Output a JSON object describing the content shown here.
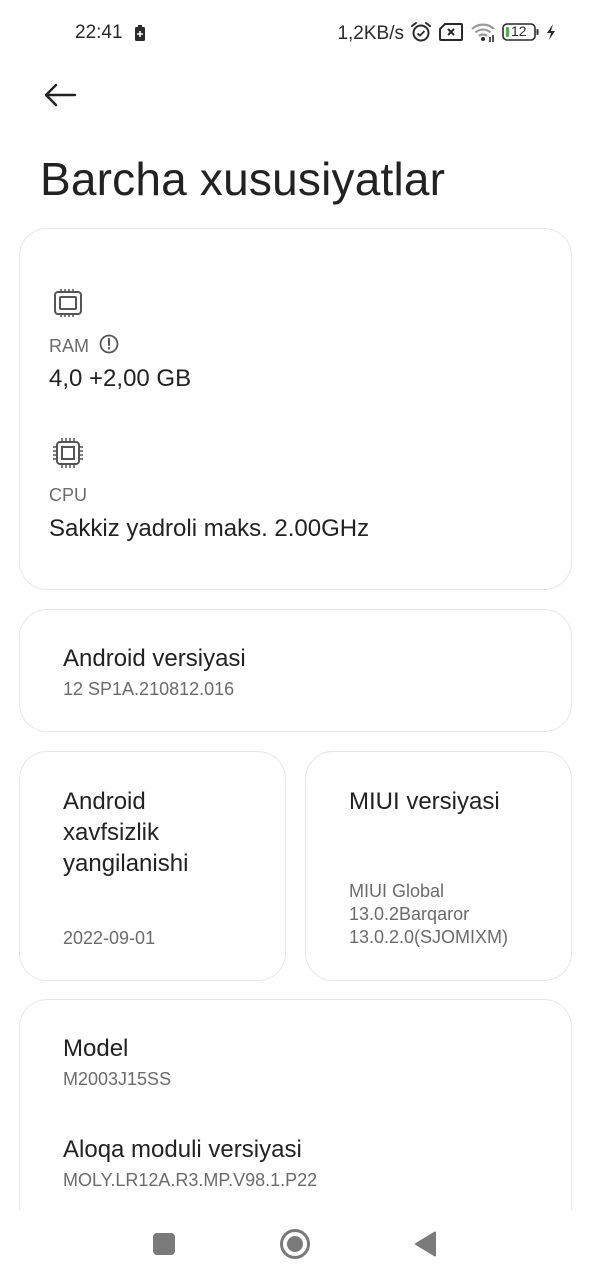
{
  "status_bar": {
    "time": "22:41",
    "network_speed": "1,2KB/s",
    "battery_level": "12",
    "icons": [
      "battery-saver-icon",
      "alarm-icon",
      "no-sim-icon",
      "wifi-icon",
      "battery-icon",
      "charging-icon"
    ]
  },
  "header": {
    "back_icon": "arrow-left-icon",
    "title": "Barcha xususiyatlar"
  },
  "hardware": {
    "ram": {
      "icon": "memory-chip-icon",
      "label": "RAM",
      "info_icon": "info-circle-icon",
      "value": "4,0 +2,00 GB"
    },
    "cpu": {
      "icon": "cpu-chip-icon",
      "label": "CPU",
      "value": "Sakkiz yadroli maks. 2.00GHz"
    }
  },
  "android_version": {
    "title": "Android versiyasi",
    "value": "12 SP1A.210812.016"
  },
  "security_update": {
    "title_lines": [
      "Android",
      "xavfsizlik",
      "yangilanishi"
    ],
    "value": "2022-09-01"
  },
  "miui_version": {
    "title": "MIUI versiyasi",
    "value_lines": [
      "MIUI Global",
      "13.0.2Barqaror",
      "13.0.2.0(SJOMIXM)"
    ]
  },
  "model": {
    "title": "Model",
    "value": "M2003J15SS"
  },
  "baseband": {
    "title": "Aloqa moduli versiyasi",
    "value": "MOLY.LR12A.R3.MP.V98.1.P22"
  },
  "nav_bar": {
    "recents_icon": "square-recents-icon",
    "home_icon": "circle-home-icon",
    "back_icon": "triangle-back-icon"
  },
  "colors": {
    "text_primary": "#222222",
    "text_secondary": "#6b6b6b",
    "card_border": "#e8e8e8",
    "nav_icon": "#7a7a7a",
    "battery_fill": "#4caf50"
  }
}
